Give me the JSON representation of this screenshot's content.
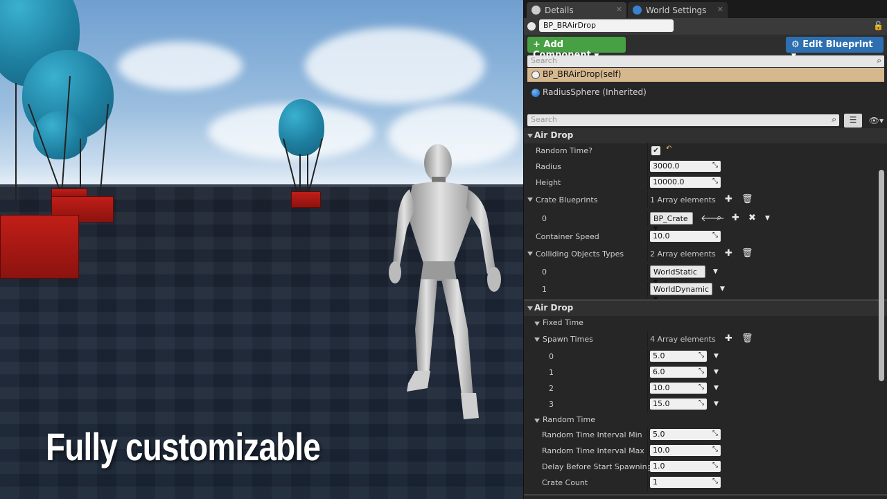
{
  "overlay": {
    "headline": "Fully customizable"
  },
  "tabs": [
    {
      "label": "Details",
      "icon": "info-icon"
    },
    {
      "label": "World Settings",
      "icon": "globe-icon"
    }
  ],
  "actor": {
    "name": "BP_BRAirDrop"
  },
  "toolbar": {
    "add_component": "+ Add Component",
    "edit_blueprint": "Edit Blueprint"
  },
  "components": {
    "search_placeholder": "Search",
    "items": [
      "BP_BRAirDrop(self)",
      "RadiusSphere (Inherited)"
    ]
  },
  "details": {
    "search_placeholder": "Search",
    "categories": [
      {
        "name": "Air Drop",
        "rows": {
          "random_time_label": "Random Time?",
          "random_time_checked": true,
          "radius_label": "Radius",
          "radius_value": "3000.0",
          "height_label": "Height",
          "height_value": "10000.0",
          "crate_blueprints_label": "Crate Blueprints",
          "crate_blueprints_count": "1 Array elements",
          "crate_index_0": "0",
          "crate_value_0": "BP_Crate",
          "container_speed_label": "Container Speed",
          "container_speed_value": "10.0",
          "colliding_label": "Colliding Objects Types",
          "colliding_count": "2 Array elements",
          "colliding_index_0": "0",
          "colliding_value_0": "WorldStatic",
          "colliding_index_1": "1",
          "colliding_value_1": "WorldDynamic"
        }
      },
      {
        "name": "Air Drop",
        "fixed_time": {
          "name": "Fixed Time",
          "spawn_times_label": "Spawn Times",
          "spawn_times_count": "4 Array elements",
          "items": [
            {
              "index": "0",
              "value": "5.0"
            },
            {
              "index": "1",
              "value": "6.0"
            },
            {
              "index": "2",
              "value": "10.0"
            },
            {
              "index": "3",
              "value": "15.0"
            }
          ]
        },
        "random_time": {
          "name": "Random Time",
          "interval_min_label": "Random Time Interval Min",
          "interval_min_value": "5.0",
          "interval_max_label": "Random Time Interval Max",
          "interval_max_value": "10.0",
          "delay_label": "Delay Before Start Spawning",
          "delay_value": "1.0",
          "crate_count_label": "Crate Count",
          "crate_count_value": "1"
        }
      }
    ]
  },
  "colors": {
    "add_button": "#47a043",
    "edit_button": "#2d6fb0",
    "selected_row": "#d6b88f"
  }
}
